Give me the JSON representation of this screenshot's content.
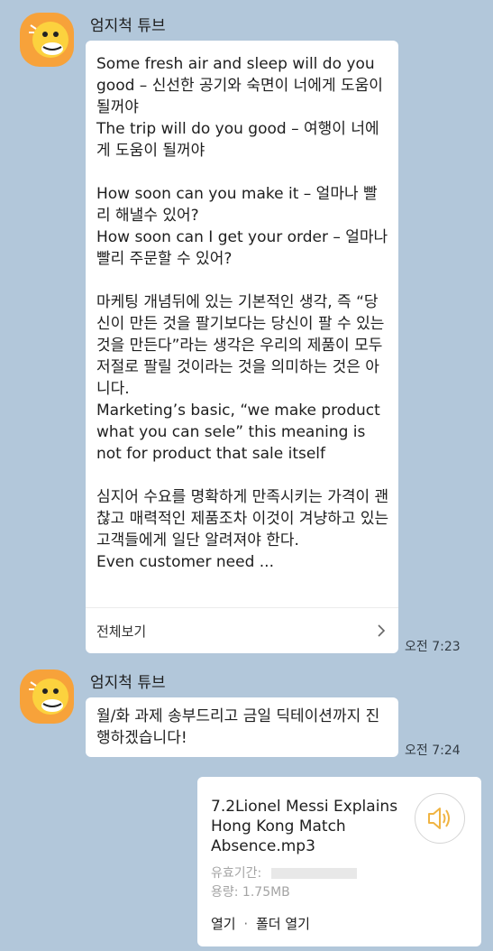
{
  "messages": [
    {
      "sender": "엄지척 튜브",
      "text": "Some fresh air and sleep will do you good – 신선한 공기와 숙면이 너에게 도움이 될꺼야\nThe trip will do you good – 여행이 너에게 도움이 될꺼야\n\nHow soon can you make it – 얼마나 빨리 해낼수 있어?\nHow soon can I get your order – 얼마나 빨리 주문할 수 있어?\n\n마케팅 개념뒤에 있는 기본적인 생각, 즉 “당신이 만든 것을 팔기보다는 당신이 팔 수 있는 것을 만든다”라는 생각은 우리의 제품이 모두 저절로 팔릴 것이라는 것을 의미하는 것은 아니다.\nMarketing’s basic, “we make product what you can sele” this meaning is not for product that sale itself\n\n심지어 수요를 명확하게 만족시키는 가격이 괜찮고 매력적인 제품조차 이것이 겨냥하고 있는 고객들에게 일단 알려져야 한다.\nEven customer need ...",
      "more_label": "전체보기",
      "time": "오전 7:23"
    },
    {
      "sender": "엄지척 튜브",
      "text": "월/화 과제 송부드리고 금일 딕테이션까지 진행하겠습니다!",
      "time": "오전 7:24"
    }
  ],
  "file": {
    "name": "7.2Lionel Messi Explains Hong Kong Match Absence.mp3",
    "expiry_label": "유효기간:",
    "size_label": "용량: 1.75MB",
    "open_label": "열기",
    "separator": "·",
    "open_folder_label": "폴더 열기"
  },
  "colors": {
    "background": "#b2c7da",
    "bubble": "#ffffff",
    "avatar": "#f7a23a",
    "speaker_icon": "#f0b443"
  },
  "icons": {
    "avatar": "duck-character-icon",
    "more": "chevron-right-icon",
    "audio": "speaker-icon"
  }
}
